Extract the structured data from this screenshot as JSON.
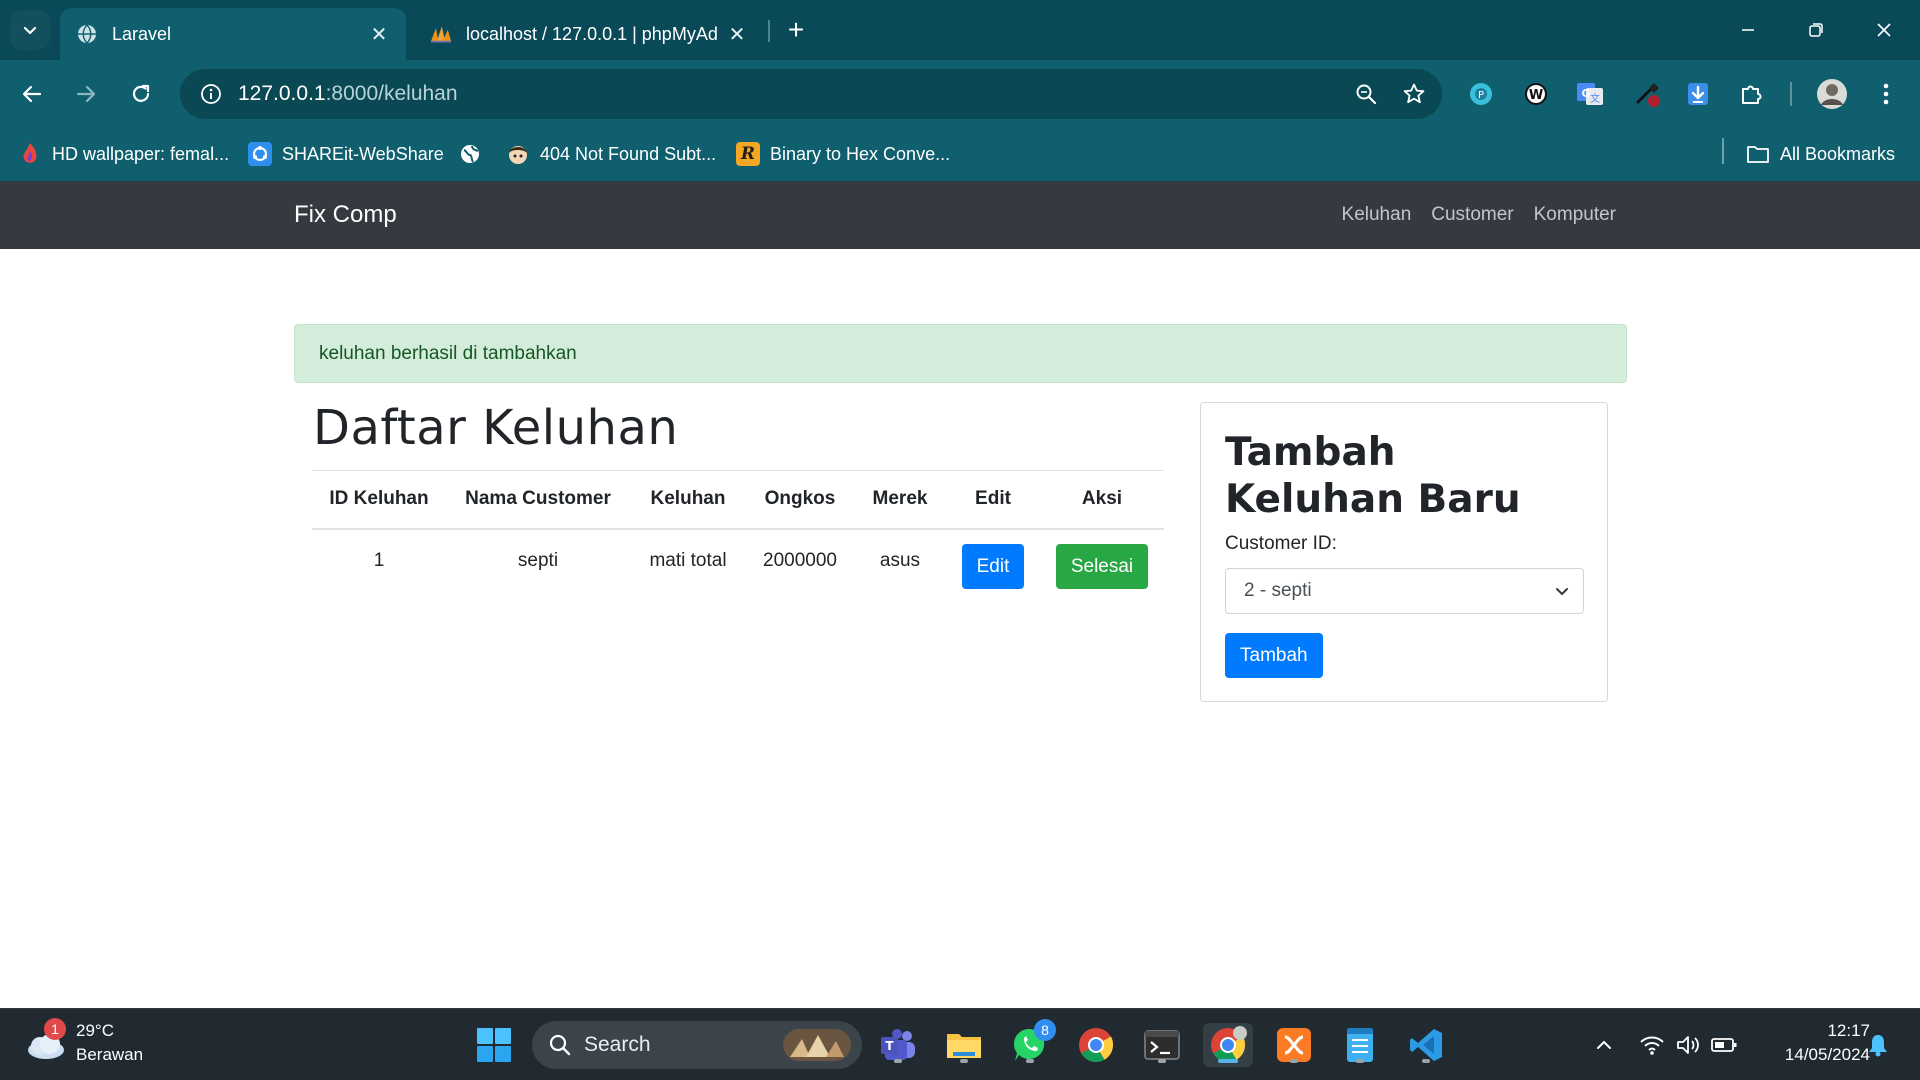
{
  "browser": {
    "tabs": [
      {
        "title": "Laravel",
        "active": true
      },
      {
        "title": "localhost / 127.0.0.1 | phpMyAd",
        "active": false
      }
    ],
    "url_host": "127.0.0.1",
    "url_rest": ":8000/keluhan",
    "bookmarks": [
      {
        "label": "HD wallpaper: femal..."
      },
      {
        "label": "SHAREit-WebShare"
      },
      {
        "label": ""
      },
      {
        "label": "404 Not Found Subt..."
      },
      {
        "label": "Binary to Hex Conve..."
      }
    ],
    "all_bookmarks_label": "All Bookmarks",
    "accent": "#0f5f6e"
  },
  "navbar": {
    "brand": "Fix Comp",
    "links": [
      "Keluhan",
      "Customer",
      "Komputer"
    ]
  },
  "alert": {
    "message": "keluhan berhasil di tambahkan"
  },
  "list": {
    "heading": "Daftar Keluhan",
    "columns": [
      "ID Keluhan",
      "Nama Customer",
      "Keluhan",
      "Ongkos",
      "Merek",
      "Edit",
      "Aksi"
    ],
    "rows": [
      {
        "id": "1",
        "customer": "septi",
        "keluhan": "mati total",
        "ongkos": "2000000",
        "merek": "asus",
        "edit_label": "Edit",
        "aksi_label": "Selesai"
      }
    ]
  },
  "form": {
    "title": "Tambah Keluhan Baru",
    "customer_label": "Customer ID:",
    "customer_selected": "2 - septi",
    "submit_label": "Tambah"
  },
  "taskbar": {
    "weather_temp": "29°C",
    "weather_desc": "Berawan",
    "weather_badge": "1",
    "search_placeholder": "Search",
    "whatsapp_badge": "8",
    "time": "12:17",
    "date": "14/05/2024"
  }
}
